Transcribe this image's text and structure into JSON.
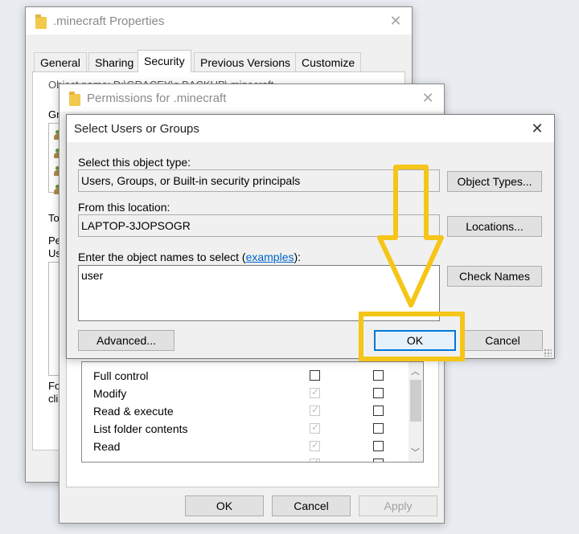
{
  "props_window": {
    "title": ".minecraft Properties",
    "tabs": [
      {
        "label": "General",
        "active": false
      },
      {
        "label": "Sharing",
        "active": false
      },
      {
        "label": "Security",
        "active": true
      },
      {
        "label": "Previous Versions",
        "active": false
      },
      {
        "label": "Customize",
        "active": false
      }
    ],
    "object_name_partial": "Object name:   D:\\GRACEY\\s BACKUP\\.minecraft",
    "clipped_labels": [
      "Gr",
      "To",
      "Pe",
      "Us",
      "Fo",
      "cli"
    ]
  },
  "permissions_window": {
    "title": "Permissions for .minecraft",
    "permissions": [
      {
        "label": "Full control",
        "allow_checked": false,
        "deny_checked": false
      },
      {
        "label": "Modify",
        "allow_checked": true,
        "deny_checked": false
      },
      {
        "label": "Read & execute",
        "allow_checked": true,
        "deny_checked": false
      },
      {
        "label": "List folder contents",
        "allow_checked": true,
        "deny_checked": false
      },
      {
        "label": "Read",
        "allow_checked": true,
        "deny_checked": false
      }
    ],
    "ok_label": "OK",
    "cancel_label": "Cancel",
    "apply_label": "Apply"
  },
  "select_dialog": {
    "title": "Select Users or Groups",
    "object_type_label": "Select this object type:",
    "object_type_value": "Users, Groups, or Built-in security principals",
    "object_types_button": "Object Types...",
    "location_label": "From this location:",
    "location_value": "LAPTOP-3JOPSOGR",
    "locations_button": "Locations...",
    "enter_names_prefix": "Enter the object names to select (",
    "examples_link": "examples",
    "enter_names_suffix": "):",
    "names_value": "user",
    "check_names_button": "Check Names",
    "advanced_button": "Advanced...",
    "ok_button": "OK",
    "cancel_button": "Cancel"
  },
  "annotation": {
    "color": "#f5c518",
    "arrow_icon": "down-arrow-icon",
    "highlight": "ok-button-highlight"
  }
}
